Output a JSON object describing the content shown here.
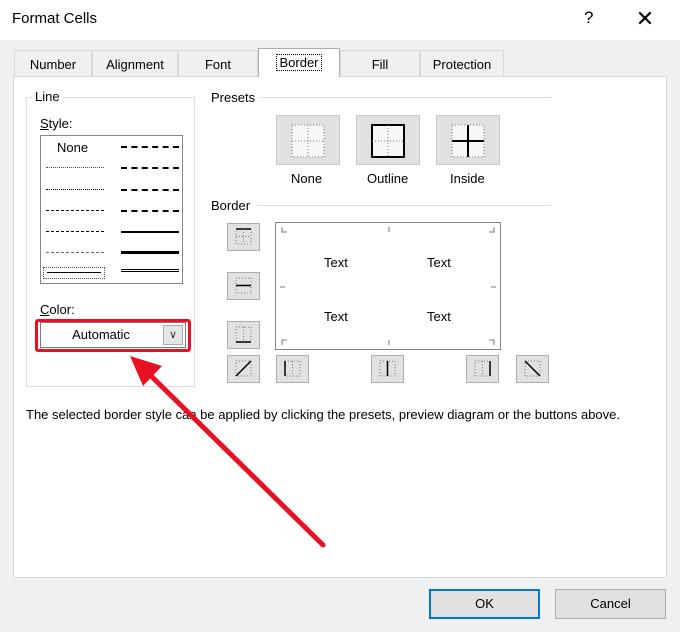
{
  "window": {
    "title": "Format Cells",
    "help_label": "?",
    "close_label": "✕"
  },
  "tabs": [
    {
      "label": "Number"
    },
    {
      "label": "Alignment"
    },
    {
      "label": "Font"
    },
    {
      "label": "Border"
    },
    {
      "label": "Fill"
    },
    {
      "label": "Protection"
    }
  ],
  "active_tab": "Border",
  "line_group": {
    "label": "Line",
    "style_label": "Style:",
    "style_none": "None",
    "color_label": "Color:",
    "color_value": "Automatic"
  },
  "presets": {
    "label": "Presets",
    "items": [
      {
        "label": "None",
        "icon": "preset-none-icon"
      },
      {
        "label": "Outline",
        "icon": "preset-outline-icon"
      },
      {
        "label": "Inside",
        "icon": "preset-inside-icon"
      }
    ]
  },
  "border": {
    "label": "Border",
    "preview_texts": [
      "Text",
      "Text",
      "Text",
      "Text"
    ]
  },
  "help_text": "The selected border style can be applied by clicking the presets, preview diagram or the buttons above.",
  "buttons": {
    "ok": "OK",
    "cancel": "Cancel"
  },
  "annotation": {
    "color": "#e81123"
  }
}
